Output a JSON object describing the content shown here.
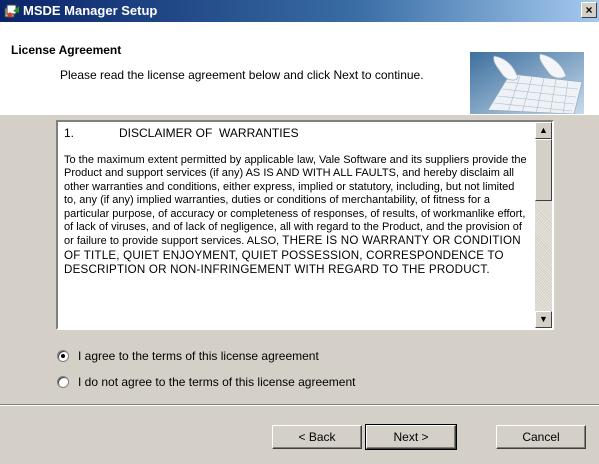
{
  "window": {
    "title": "MSDE Manager Setup",
    "close_glyph": "×"
  },
  "header": {
    "title": "License Agreement",
    "subtitle": "Please read the license agreement below and click Next to continue."
  },
  "license": {
    "heading_number": "1.",
    "heading_text": "DISCLAIMER OF  WARRANTIES",
    "body_text": "To the maximum extent permitted by applicable law, Vale Software and its suppliers provide the Product and support services (if any) AS IS AND WITH ALL FAULTS, and hereby disclaim all other warranties and conditions, either express, implied or statutory, including, but not limited to, any (if any) implied warranties, duties or conditions of merchantability, of fitness for a particular purpose, of accuracy or completeness of responses, of results, of workmanlike effort, of lack of viruses, and of lack of negligence, all with regard to the Product, and the provision of or failure to provide support services.  ALSO, ",
    "body_upper": "THERE IS NO WARRANTY OR CONDITION OF TITLE, QUIET ENJOYMENT, QUIET POSSESSION, CORRESPONDENCE TO DESCRIPTION OR NON-INFRINGEMENT WITH REGARD TO THE PRODUCT."
  },
  "options": {
    "agree_label": "I agree to the terms of this license agreement",
    "disagree_label": "I do not agree to the terms of this license agreement",
    "selected": "agree"
  },
  "buttons": {
    "back_label": "< Back",
    "next_label": "Next >",
    "cancel_label": "Cancel"
  },
  "icons": {
    "title_icon": "setup-icon",
    "header_art": "keyboard-hands-icon",
    "scroll_up": "arrow-up-icon",
    "scroll_down": "arrow-down-icon"
  },
  "colors": {
    "dialog_bg": "#d4d0c8",
    "titlebar_start": "#0a246a",
    "titlebar_end": "#a6caf0"
  }
}
